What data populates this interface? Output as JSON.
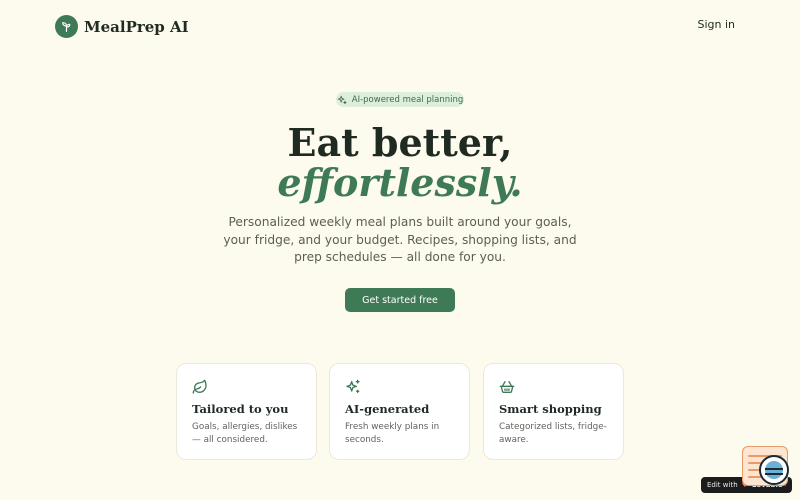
{
  "header": {
    "brand": "MealPrep AI",
    "sign_in": "Sign in"
  },
  "hero": {
    "badge": "AI-powered meal planning",
    "title_line1": "Eat better,",
    "title_line2": "effortlessly.",
    "subtitle": "Personalized weekly meal plans built around your goals, your fridge, and your budget. Recipes, shopping lists, and prep schedules — all done for you.",
    "cta": "Get started free"
  },
  "features": [
    {
      "icon": "leaf-icon",
      "title": "Tailored to you",
      "desc": "Goals, allergies, dislikes — all considered."
    },
    {
      "icon": "sparkles-icon",
      "title": "AI-generated",
      "desc": "Fresh weekly plans in seconds."
    },
    {
      "icon": "basket-icon",
      "title": "Smart shopping",
      "desc": "Categorized lists, fridge-aware."
    }
  ],
  "edit_badge": {
    "label": "Edit with",
    "brand": "Lovable",
    "close": "×"
  },
  "colors": {
    "background": "#fdfaee",
    "accent": "#3f7a57",
    "text": "#1f2a22"
  }
}
